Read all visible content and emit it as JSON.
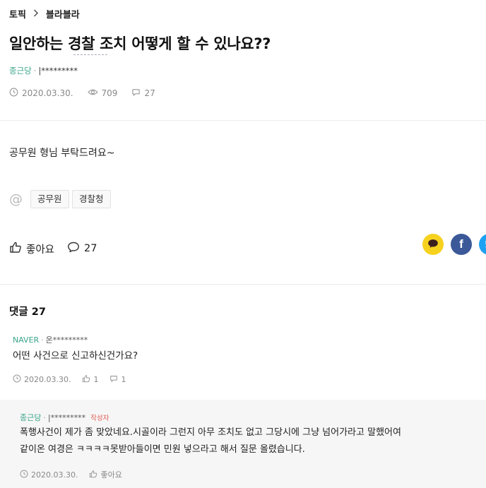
{
  "breadcrumb": {
    "board": "토픽",
    "sub": "블라블라",
    "separator": ">"
  },
  "post": {
    "title": "일안하는 경찰 조치 어떻게 할 수 있나요??",
    "author_name": "종근당",
    "author_sep": "·",
    "author_id": "|*********",
    "date": "2020.03.30.",
    "views": "709",
    "comment_count": "27",
    "body": "공무원 형님 부탁드려요~",
    "tag_symbol": "@",
    "tags": [
      "공무원",
      "경찰청"
    ],
    "like_label": "좋아요",
    "comment_action_count": "27"
  },
  "share": {
    "kakao_icon": "kakao-talk-icon",
    "facebook_label": "f",
    "twitter_icon": "twitter-icon"
  },
  "comments_section": {
    "title": "댓글 27",
    "comments": [
      {
        "author_name": "NAVER",
        "author_sep": "·",
        "author_id": "온*********",
        "text": "어떤 사건으로 신고하신건가요?",
        "date": "2020.03.30.",
        "likes": "1",
        "replies": "1"
      }
    ],
    "reply": {
      "author_name": "종근당",
      "author_sep": "·",
      "author_id": "|*********",
      "badge": "작성자",
      "text_line1": "폭행사건이 제가 좀 맞았네요.시골이라 그런지 아무 조치도 없고 그당시에 그냥 넘어가라고 말했어여",
      "text_line2": "같이온 여경은 ㅋㅋㅋㅋ못받아들이면 민원 넣으라고 해서 질문 올렸습니다.",
      "date": "2020.03.30.",
      "like_label": "좋아요"
    }
  },
  "colors": {
    "accent_green": "#3aa58a",
    "kakao": "#f6d21e",
    "facebook": "#3b5998",
    "twitter": "#1da1f2",
    "badge_red": "#e05a4f"
  }
}
